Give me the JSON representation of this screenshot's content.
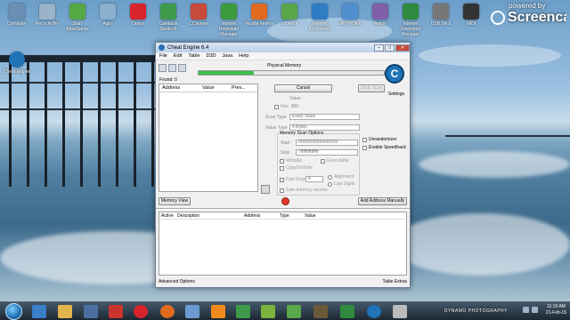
{
  "watermark": {
    "line1": "powered by",
    "line2": "Screencast-O-Matic.com"
  },
  "desktop_icons": [
    {
      "label": "Computer",
      "color": "#6a8fb5"
    },
    {
      "label": "Recycle Bin",
      "color": "#9bb3c8"
    },
    {
      "label": "Start BlueStacks",
      "color": "#55a843"
    },
    {
      "label": "Apps",
      "color": "#8ab0d0"
    },
    {
      "label": "Opera",
      "color": "#d9232d"
    },
    {
      "label": "Camtasia Studio 8",
      "color": "#3e9a4a"
    },
    {
      "label": "CCleaner",
      "color": "#c84a3a"
    },
    {
      "label": "Internet Download Manager",
      "color": "#3b9a3b"
    },
    {
      "label": "Mozilla Firefox",
      "color": "#e06a1f"
    },
    {
      "label": "uTorrent",
      "color": "#5aa64a"
    },
    {
      "label": "Internet Accelerator",
      "color": "#2f7cc4"
    },
    {
      "label": "NETWORK",
      "color": "#4f8fd0"
    },
    {
      "label": "Anime",
      "color": "#7f5fa8"
    },
    {
      "label": "Internet Download Manager",
      "color": "#2e8a3e"
    },
    {
      "label": "USB Stick",
      "color": "#777777"
    },
    {
      "label": "MIDI",
      "color": "#333333"
    }
  ],
  "side_icon": {
    "label": "Cheat Engine"
  },
  "window": {
    "title": "Cheat Engine 6.4",
    "menu": [
      "File",
      "Edit",
      "Table",
      "D3D",
      "Java",
      "Help"
    ],
    "process_label": "Physical Memory",
    "progress": 0.3,
    "found": "Found: 0",
    "list_columns": [
      "Address",
      "Value",
      "Prev..."
    ],
    "settings_label": "Settings",
    "cancel": "Cancel",
    "undo_scan": "Undo Scan",
    "value_label": "Value:",
    "hex": "Hex",
    "value_text": "890",
    "scan_type_label": "Scan Type",
    "scan_type": "Exact Value",
    "value_type_label": "Value Type",
    "value_type": "4 Bytes",
    "memory_scan_options": "Memory Scan Options",
    "start_label": "Start",
    "start_value": "0000000000000000",
    "stop_label": "Stop",
    "stop_value": "7fffffffffffffff",
    "writable": "Writable",
    "executable": "Executable",
    "copyonwrite": "CopyOnWrite",
    "unrandomizer": "Unrandomizer",
    "enable_speedhack": "Enable Speedhack",
    "fast_scan": "Fast Scan",
    "fast_scan_value": "4",
    "alignment": "Alignment",
    "last_digits": "Last Digits",
    "safe_memory": "Safe memory access",
    "memory_view": "Memory View",
    "add_address": "Add Address Manually",
    "table_columns": [
      "Active",
      "Description",
      "Address",
      "Type",
      "Value"
    ],
    "advanced_options": "Advanced Options",
    "table_extras": "Table Extras"
  },
  "taskbar": {
    "brand": "DYNAMO PHOTOGRAPHY",
    "time": "11:19 AM",
    "date": "21-Feb-15"
  }
}
